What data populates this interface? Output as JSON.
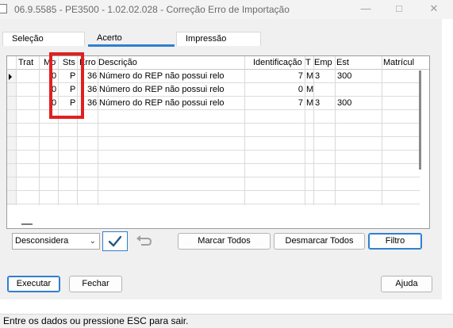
{
  "window": {
    "title": "06.9.5585 - PE3500 - 1.02.02.028 - Correção Erro de Importação",
    "minimize_icon": "minimize-icon",
    "maximize_icon": "maximize-icon",
    "close_icon": "close-icon"
  },
  "tabs": [
    {
      "label": "Seleção"
    },
    {
      "label": "Acerto",
      "active": true
    },
    {
      "label": "Impressão"
    }
  ],
  "grid": {
    "columns": [
      "Trat",
      "Mot",
      "Sts",
      "Erro",
      "Descrição",
      "Identificação",
      "T",
      "Emp",
      "Est",
      "Matrícul"
    ],
    "rows": [
      {
        "pointer": true,
        "mot": "0",
        "sts": "P",
        "erro": "36",
        "descricao": "Número do REP não possui relo",
        "identificacao": "7",
        "t": "M",
        "emp": "3",
        "est": "300"
      },
      {
        "pointer": false,
        "mot": "0",
        "sts": "P",
        "erro": "36",
        "descricao": "Número do REP não possui relo",
        "identificacao": "0",
        "t": "M",
        "emp": "",
        "est": ""
      },
      {
        "pointer": false,
        "mot": "0",
        "sts": "P",
        "erro": "36",
        "descricao": "Número do REP não possui relo",
        "identificacao": "7",
        "t": "M",
        "emp": "3",
        "est": "300"
      }
    ]
  },
  "controls": {
    "action_select": "Desconsidera",
    "confirm_icon": "checkmark-icon",
    "undo_icon": "undo-icon",
    "marcar_todos": "Marcar Todos",
    "desmarcar_todos": "Desmarcar Todos",
    "filtro": "Filtro"
  },
  "footer": {
    "executar": "Executar",
    "fechar": "Fechar",
    "ajuda": "Ajuda"
  },
  "status_bar": "Entre os dados ou pressione ESC para sair.",
  "colors": {
    "accent": "#2f7fd0",
    "highlight": "#e02020"
  }
}
